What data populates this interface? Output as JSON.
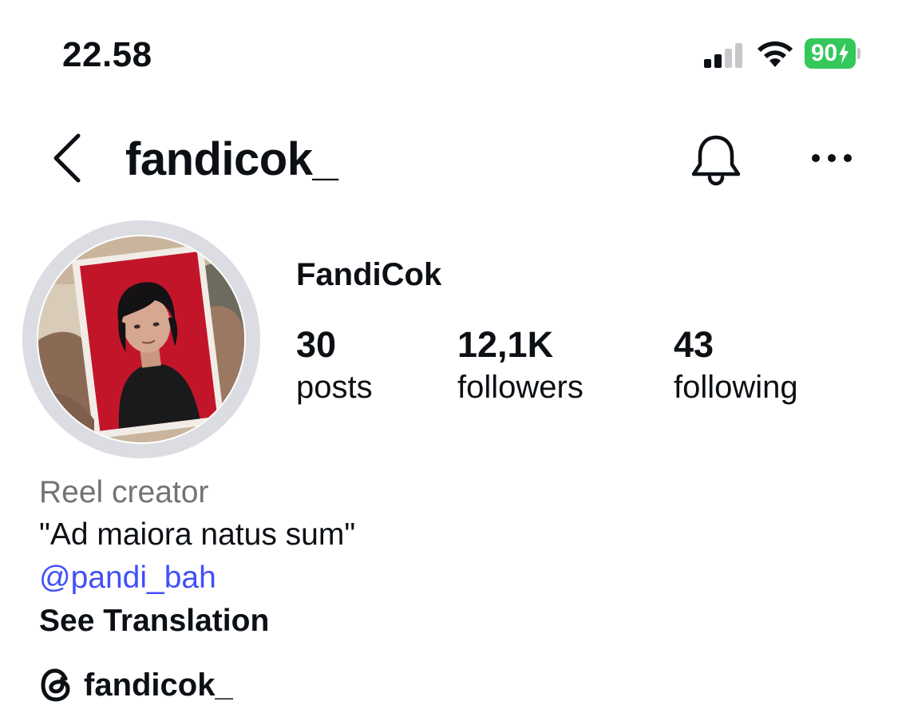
{
  "status_bar": {
    "time": "22.58",
    "battery_percent": "90",
    "battery_charging": true,
    "battery_color": "#34c759"
  },
  "header": {
    "username": "fandicok_",
    "back_icon": "chevron-left-icon",
    "notification_icon": "bell-icon",
    "more_icon": "more-horizontal-icon"
  },
  "profile": {
    "display_name": "FandiCok",
    "avatar_ring_color": "#dbdde2",
    "stats": [
      {
        "value": "30",
        "label": "posts"
      },
      {
        "value": "12,1K",
        "label": "followers"
      },
      {
        "value": "43",
        "label": "following"
      }
    ]
  },
  "bio": {
    "category": "Reel creator",
    "text": "\"Ad maiora natus sum\"",
    "mention": "@pandi_bah",
    "mention_color": "#4150f7",
    "translation_link": "See Translation"
  },
  "threads": {
    "icon": "threads-icon",
    "handle": "fandicok_"
  }
}
